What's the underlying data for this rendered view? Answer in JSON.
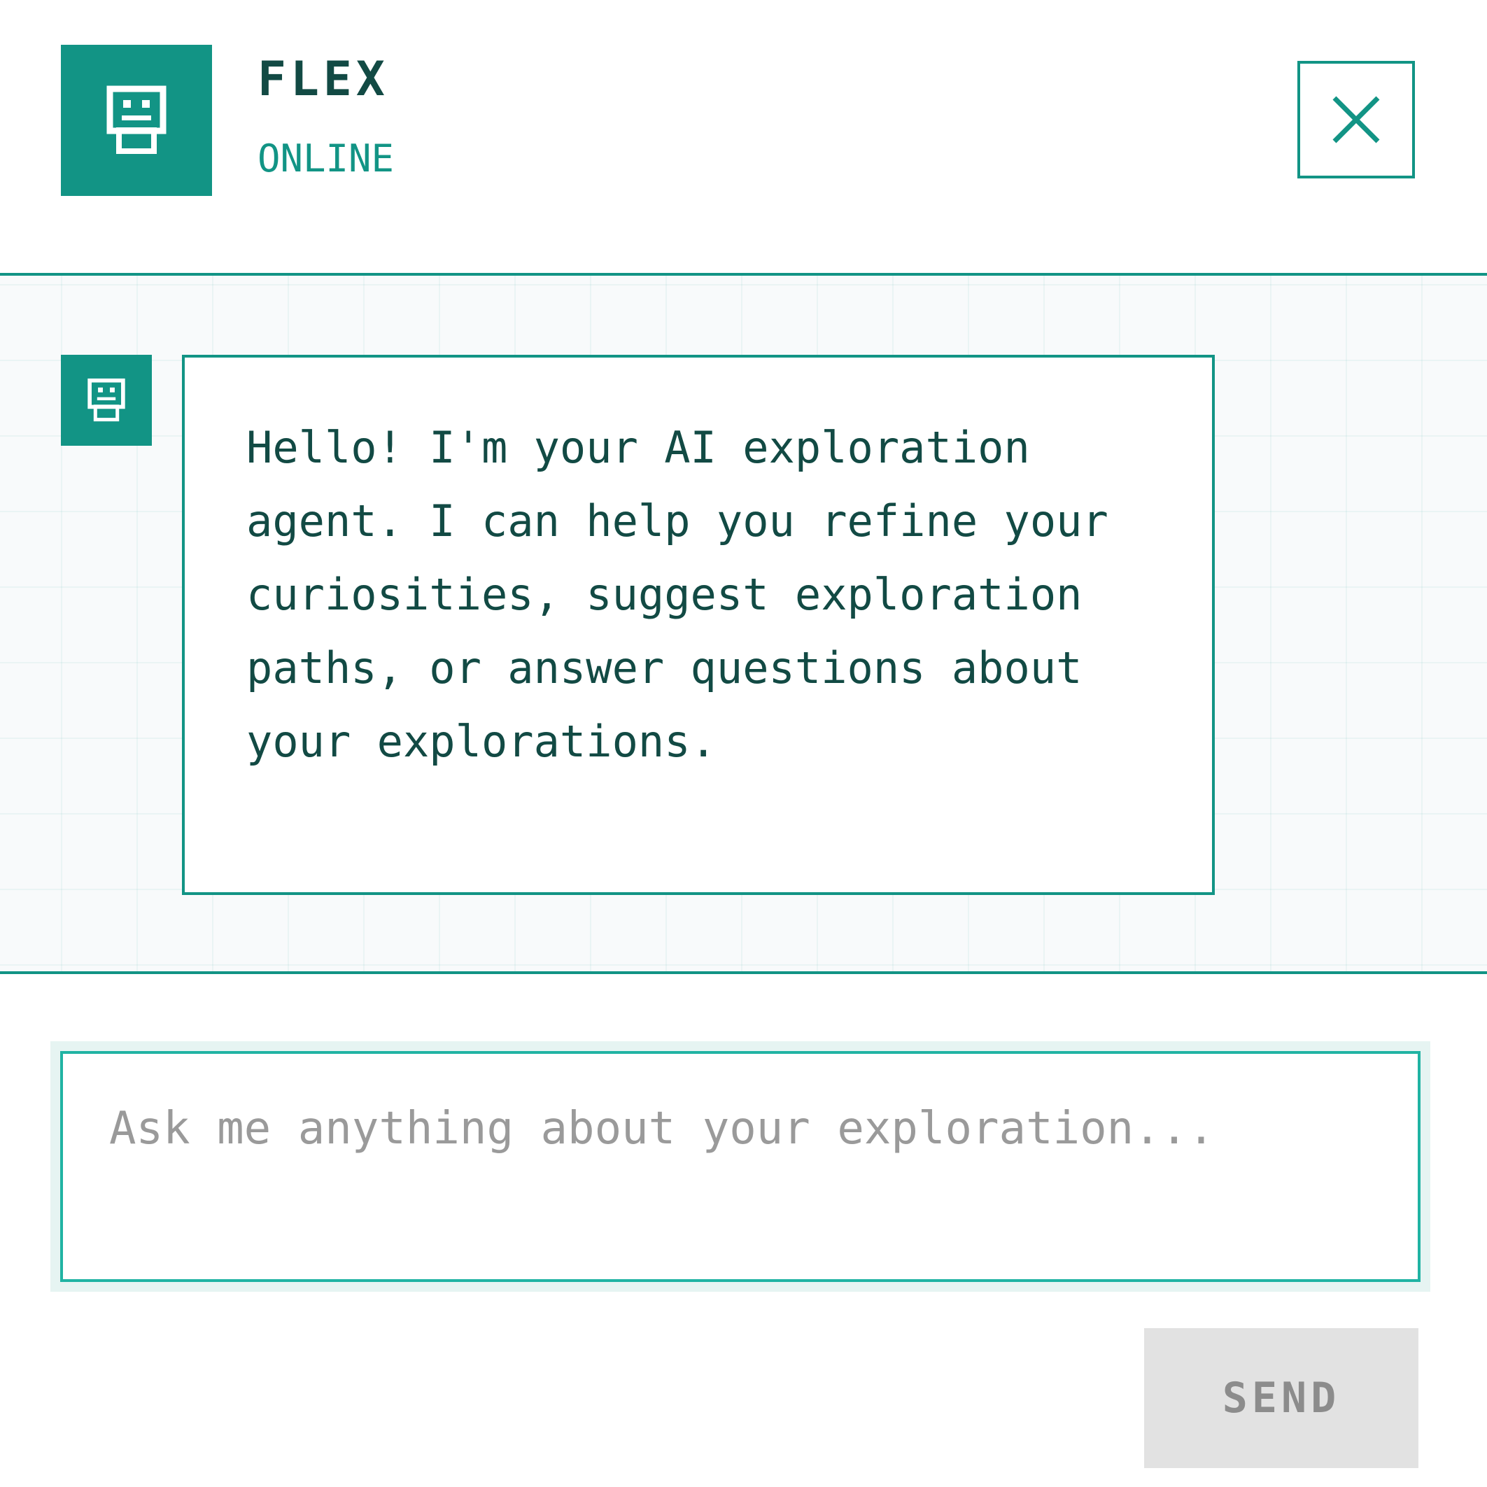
{
  "header": {
    "agent_name": "FLEX",
    "status": "ONLINE",
    "avatar_icon": "robot-icon",
    "close_icon": "close-icon"
  },
  "messages": [
    {
      "sender": "agent",
      "avatar_icon": "robot-icon",
      "text": "Hello! I'm your AI exploration agent. I can help you refine your curiosities, suggest exploration paths, or answer questions about your explorations."
    }
  ],
  "composer": {
    "placeholder": "Ask me anything about your exploration...",
    "value": "",
    "send_label": "SEND"
  },
  "colors": {
    "accent": "#129485",
    "text_dark": "#124a44",
    "input_border": "#20b3a3",
    "send_disabled_bg": "#e2e2e2",
    "send_disabled_text": "#8c8c8c"
  }
}
